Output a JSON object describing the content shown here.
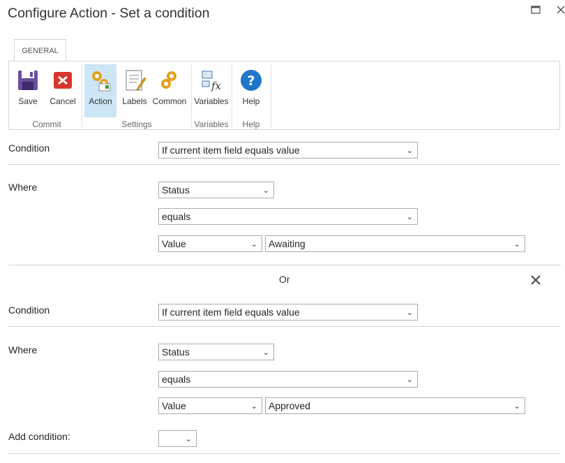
{
  "window": {
    "title": "Configure Action - Set a condition"
  },
  "tabs": [
    {
      "label": "GENERAL"
    }
  ],
  "ribbon": {
    "buttons": {
      "save": "Save",
      "cancel": "Cancel",
      "action": "Action",
      "labels": "Labels",
      "common": "Common",
      "variables": "Variables",
      "help": "Help"
    },
    "groups": {
      "commit": "Commit",
      "settings": "Settings",
      "variables": "Variables",
      "help": "Help"
    }
  },
  "condition1": {
    "condition_label": "Condition",
    "condition_value": "If current item field equals value",
    "where_label": "Where",
    "field": "Status",
    "operator": "equals",
    "value_type": "Value",
    "value": "Awaiting"
  },
  "separator": {
    "or_label": "Or"
  },
  "condition2": {
    "condition_label": "Condition",
    "condition_value": "If current item field equals value",
    "where_label": "Where",
    "field": "Status",
    "operator": "equals",
    "value_type": "Value",
    "value": "Approved"
  },
  "add_condition": {
    "label": "Add condition:",
    "value": ""
  },
  "colors": {
    "active_button_bg": "#cde6f7",
    "border": "#d4d4d4"
  }
}
